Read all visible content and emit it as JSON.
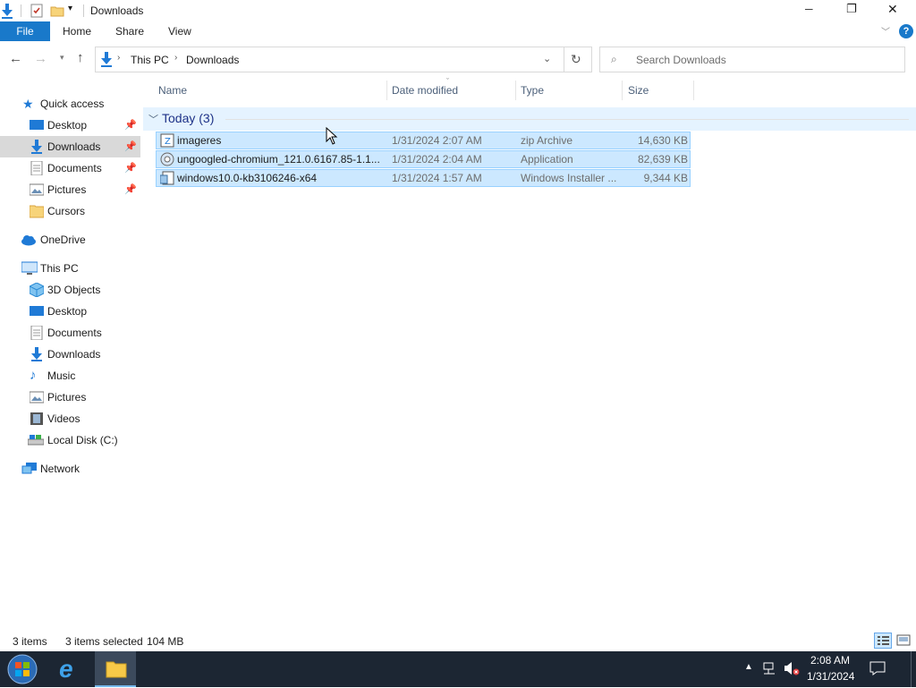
{
  "window": {
    "title": "Downloads",
    "controls": {
      "minimize": "─",
      "maximize": "❐",
      "close": "✕"
    }
  },
  "ribbon": {
    "file": "File",
    "tabs": [
      "Home",
      "Share",
      "View"
    ],
    "help": "?"
  },
  "address": {
    "crumbs": [
      "This PC",
      "Downloads"
    ],
    "search_placeholder": "Search Downloads"
  },
  "nav": {
    "quick_access": "Quick access",
    "quick_items": [
      {
        "label": "Desktop",
        "icon": "desktop-icon",
        "pinned": true
      },
      {
        "label": "Downloads",
        "icon": "downloads-icon",
        "pinned": true,
        "selected": true
      },
      {
        "label": "Documents",
        "icon": "documents-icon",
        "pinned": true
      },
      {
        "label": "Pictures",
        "icon": "pictures-icon",
        "pinned": true
      },
      {
        "label": "Cursors",
        "icon": "folder-icon",
        "pinned": false
      }
    ],
    "onedrive": "OneDrive",
    "this_pc": "This PC",
    "pc_items": [
      {
        "label": "3D Objects",
        "icon": "3d-objects-icon"
      },
      {
        "label": "Desktop",
        "icon": "desktop-icon"
      },
      {
        "label": "Documents",
        "icon": "documents-icon"
      },
      {
        "label": "Downloads",
        "icon": "downloads-icon"
      },
      {
        "label": "Music",
        "icon": "music-icon"
      },
      {
        "label": "Pictures",
        "icon": "pictures-icon"
      },
      {
        "label": "Videos",
        "icon": "videos-icon"
      },
      {
        "label": "Local Disk (C:)",
        "icon": "local-disk-icon"
      }
    ],
    "network": "Network"
  },
  "columns": {
    "name": "Name",
    "date": "Date modified",
    "type": "Type",
    "size": "Size"
  },
  "group": {
    "label": "Today (3)"
  },
  "files": [
    {
      "name": "imageres",
      "date": "1/31/2024 2:07 AM",
      "type": "zip Archive",
      "size": "14,630 KB",
      "icon": "zip-icon"
    },
    {
      "name": "ungoogled-chromium_121.0.6167.85-1.1...",
      "date": "1/31/2024 2:04 AM",
      "type": "Application",
      "size": "82,639 KB",
      "icon": "application-icon"
    },
    {
      "name": "windows10.0-kb3106246-x64",
      "date": "1/31/2024 1:57 AM",
      "type": "Windows Installer ...",
      "size": "9,344 KB",
      "icon": "installer-icon"
    }
  ],
  "status": {
    "count": "3 items",
    "selected": "3 items selected",
    "size": "104 MB"
  },
  "taskbar": {
    "time": "2:08 AM",
    "date": "1/31/2024"
  },
  "colors": {
    "accent": "#1979ca",
    "selection": "#cce8ff",
    "selection_border": "#99d1ff",
    "taskbar": "#1c2633"
  }
}
